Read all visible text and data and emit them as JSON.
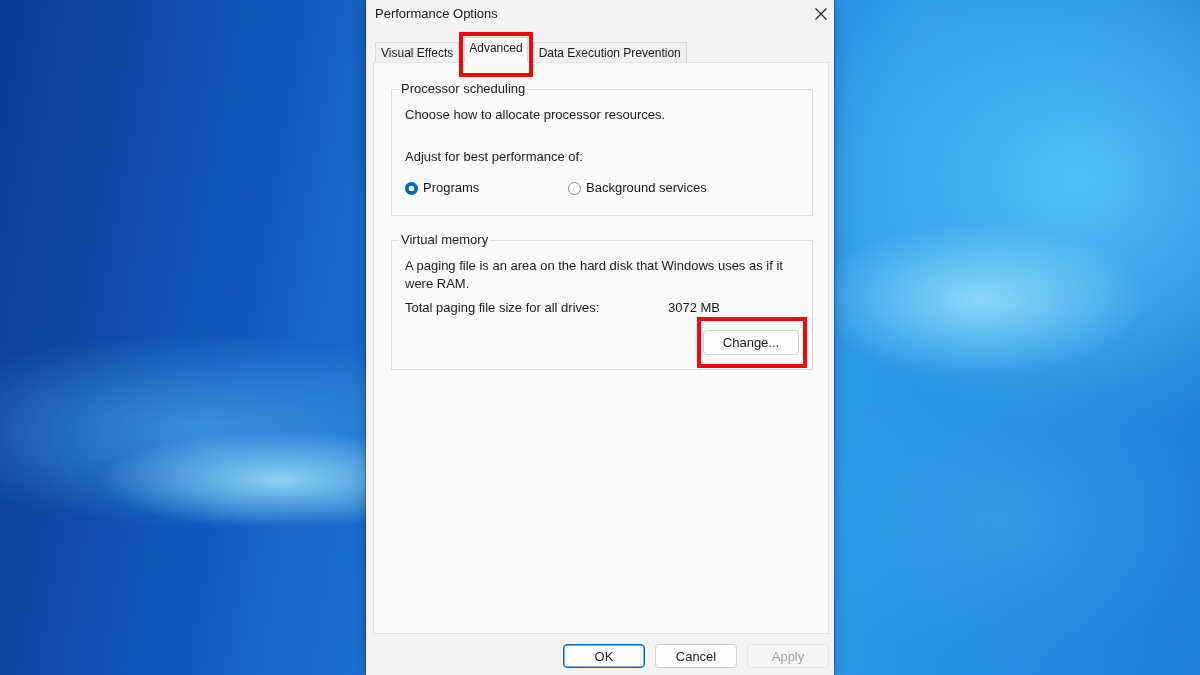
{
  "window": {
    "title": "Performance Options"
  },
  "tabs": [
    {
      "label": "Visual Effects",
      "selected": false,
      "highlighted": false
    },
    {
      "label": "Advanced",
      "selected": true,
      "highlighted": true
    },
    {
      "label": "Data Execution Prevention",
      "selected": false,
      "highlighted": false
    }
  ],
  "processor_scheduling": {
    "title": "Processor scheduling",
    "description": "Choose how to allocate processor resources.",
    "prompt": "Adjust for best performance of:",
    "options": [
      {
        "label": "Programs",
        "selected": true
      },
      {
        "label": "Background services",
        "selected": false
      }
    ]
  },
  "virtual_memory": {
    "title": "Virtual memory",
    "description": "A paging file is an area on the hard disk that Windows uses as if it were RAM.",
    "total_label": "Total paging file size for all drives:",
    "total_value": "3072 MB",
    "change_button": {
      "label": "Change...",
      "highlighted": true
    }
  },
  "buttons": [
    {
      "label": "OK",
      "default": true,
      "disabled": false
    },
    {
      "label": "Cancel",
      "default": false,
      "disabled": false
    },
    {
      "label": "Apply",
      "default": false,
      "disabled": true
    }
  ]
}
